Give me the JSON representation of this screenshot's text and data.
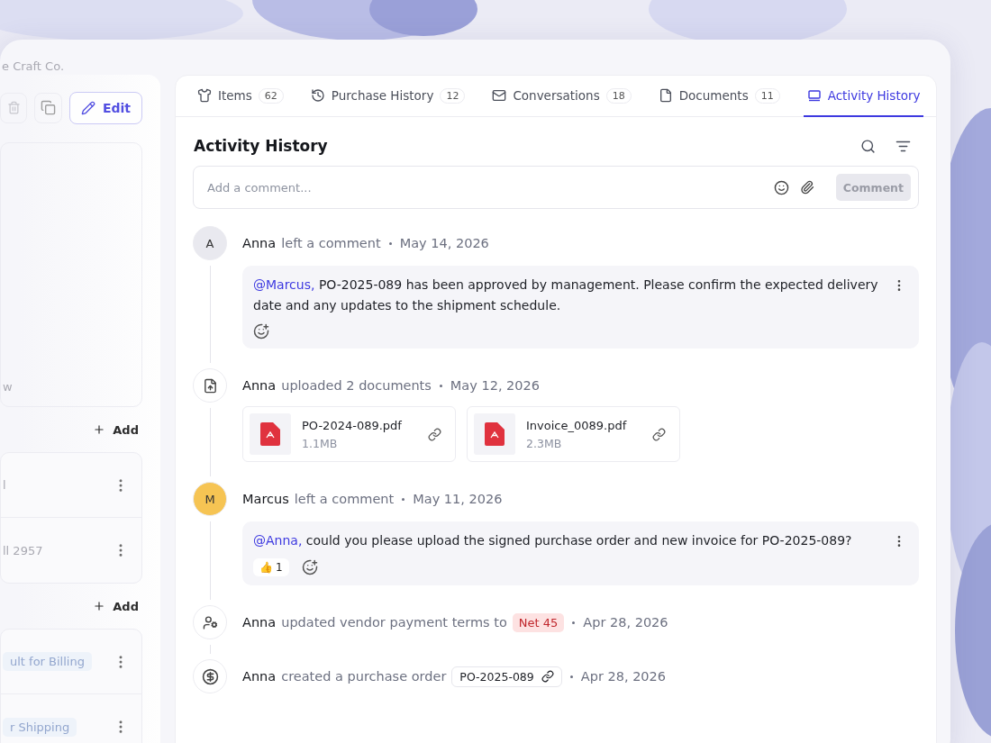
{
  "company": "e Craft Co.",
  "sidebar": {
    "edit_button": "Edit",
    "notes_fragment": "w",
    "sections": [
      {
        "add_label": "Add",
        "cards": [
          {
            "text": "l"
          },
          {
            "text": "ll 2957"
          }
        ]
      },
      {
        "add_label": "Add",
        "cards": [
          {
            "tag": "ult for Billing"
          },
          {
            "tag": "r Shipping"
          }
        ]
      }
    ]
  },
  "tabs": [
    {
      "kind": "items",
      "label": "Items",
      "count": "62",
      "selected": false
    },
    {
      "kind": "history",
      "label": "Purchase History",
      "count": "12",
      "selected": false
    },
    {
      "kind": "mail",
      "label": "Conversations",
      "count": "18",
      "selected": false
    },
    {
      "kind": "document",
      "label": "Documents",
      "count": "11",
      "selected": false
    },
    {
      "kind": "activity",
      "label": "Activity History",
      "selected": true
    }
  ],
  "panel": {
    "title": "Activity History",
    "comment_field": {
      "placeholder": "Add a comment...",
      "button": "Comment"
    }
  },
  "activities": [
    {
      "kind": "comment",
      "avatar": {
        "letter": "A",
        "color": "#e9e9ef"
      },
      "actor": "Anna",
      "action": "left a comment",
      "date": "May 14, 2026",
      "mention": "@Marcus,",
      "body": "PO-2025-089 has been approved by management. Please confirm the expected delivery date and any updates to the shipment schedule."
    },
    {
      "kind": "upload",
      "actor": "Anna",
      "action": "uploaded 2 documents",
      "date": "May 12, 2026",
      "files": [
        {
          "name": "PO-2024-089.pdf",
          "size": "1.1MB"
        },
        {
          "name": "Invoice_0089.pdf",
          "size": "2.3MB"
        }
      ]
    },
    {
      "kind": "comment",
      "avatar": {
        "letter": "M",
        "color": "#f6c453"
      },
      "actor": "Marcus",
      "action": "left a comment",
      "date": "May 11, 2026",
      "mention": "@Anna,",
      "body": "could you please upload the signed purchase order and new invoice for PO-2025-089?",
      "reactions": [
        {
          "emoji": "👍",
          "count": "1"
        }
      ]
    },
    {
      "kind": "terms",
      "actor": "Anna",
      "action": "updated vendor payment terms to",
      "badge": "Net 45",
      "date": "Apr 28, 2026"
    },
    {
      "kind": "order",
      "actor": "Anna",
      "action": "created a purchase order",
      "chip": "PO-2025-089",
      "date": "Apr 28, 2026"
    }
  ]
}
